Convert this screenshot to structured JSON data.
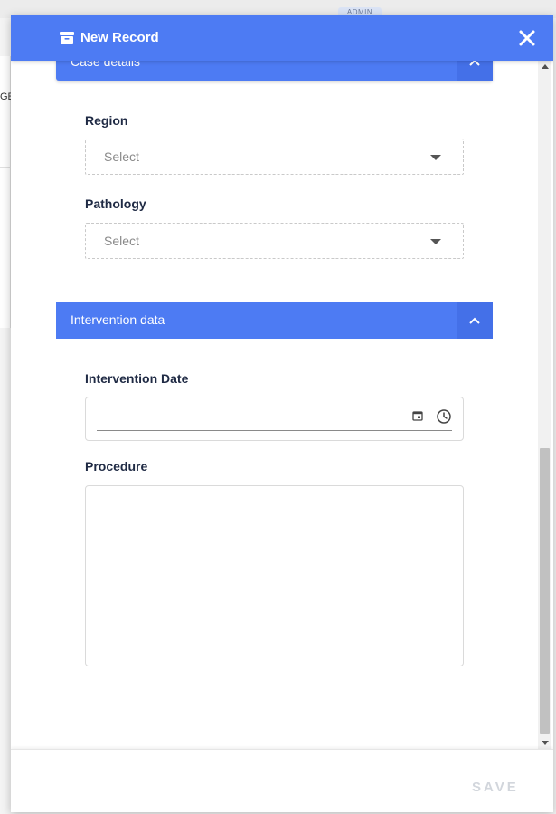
{
  "background": {
    "badge": "ADMIN",
    "left_text": "GE"
  },
  "dialog": {
    "title": "New Record",
    "header_icon": "archive-box-icon",
    "close_icon": "close-icon",
    "colors": {
      "accent": "#4d7bf3",
      "label": "#1f2a44",
      "disabled": "#d2d6dc"
    }
  },
  "sections": {
    "details": {
      "label": "Case details",
      "toggle_icon": "chevron-up-icon"
    },
    "intervention": {
      "label": "Intervention data",
      "toggle_icon": "chevron-up-icon"
    }
  },
  "fields": {
    "region": {
      "label": "Region",
      "placeholder": "Select"
    },
    "pathology": {
      "label": "Pathology",
      "placeholder": "Select"
    },
    "intervention_date": {
      "label": "Intervention Date",
      "value": ""
    },
    "procedure": {
      "label": "Procedure",
      "value": ""
    }
  },
  "footer": {
    "save_label": "SAVE"
  }
}
